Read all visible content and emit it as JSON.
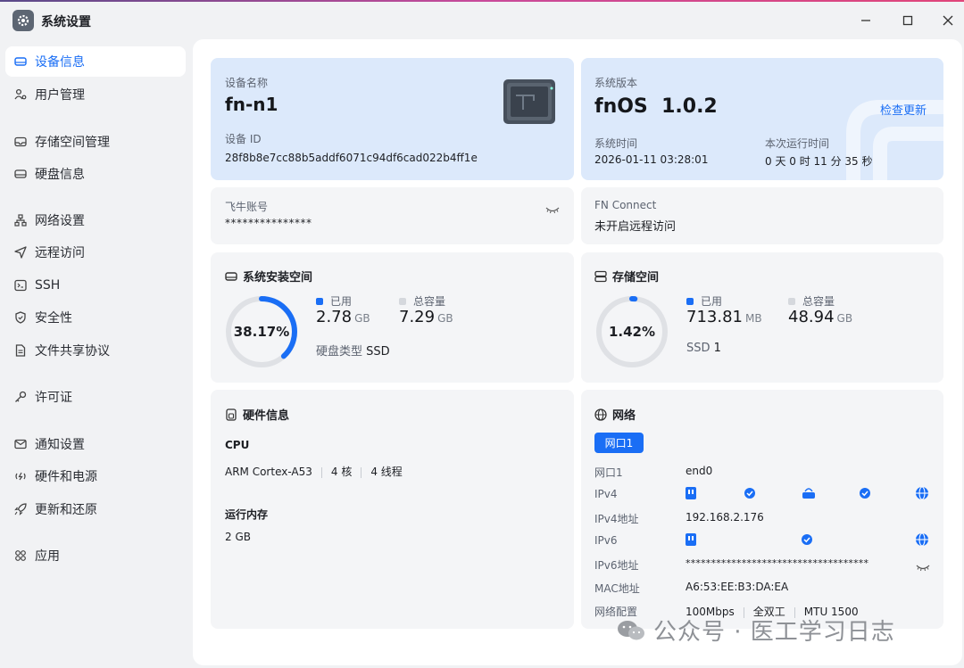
{
  "window": {
    "title": "系统设置"
  },
  "sidebar": {
    "items": [
      {
        "label": "设备信息",
        "icon": "device-icon"
      },
      {
        "label": "用户管理",
        "icon": "users-icon"
      },
      {
        "label": "存储空间管理",
        "icon": "storage-icon"
      },
      {
        "label": "硬盘信息",
        "icon": "disk-icon"
      },
      {
        "label": "网络设置",
        "icon": "network-icon"
      },
      {
        "label": "远程访问",
        "icon": "send-icon"
      },
      {
        "label": "SSH",
        "icon": "terminal-icon"
      },
      {
        "label": "安全性",
        "icon": "shield-icon"
      },
      {
        "label": "文件共享协议",
        "icon": "file-icon"
      },
      {
        "label": "许可证",
        "icon": "key-icon"
      },
      {
        "label": "通知设置",
        "icon": "mail-icon"
      },
      {
        "label": "硬件和电源",
        "icon": "power-icon"
      },
      {
        "label": "更新和还原",
        "icon": "rocket-icon"
      },
      {
        "label": "应用",
        "icon": "apps-icon"
      }
    ]
  },
  "device": {
    "name_label": "设备名称",
    "name": "fn-n1",
    "id_label": "设备 ID",
    "id": "28f8b8e7cc88b5addf6071c94df6cad022b4ff1e"
  },
  "system": {
    "version_label": "系统版本",
    "version": "fnOS  1.0.2",
    "check_update": "检查更新",
    "time_label": "系统时间",
    "time": "2026-01-11 03:28:01",
    "uptime_label": "本次运行时间",
    "uptime": "0 天 0 时 11 分 35 秒"
  },
  "account": {
    "label": "飞牛账号",
    "value": "***************"
  },
  "fnconnect": {
    "label": "FN Connect",
    "value": "未开启远程访问"
  },
  "sys_space": {
    "title": "系统安装空间",
    "percent": "38.17%",
    "percent_value": 38.17,
    "used_label": "已用",
    "used": "2.78",
    "used_unit": "GB",
    "total_label": "总容量",
    "total": "7.29",
    "total_unit": "GB",
    "disk_type_label": "硬盘类型",
    "disk_type": "SSD"
  },
  "storage": {
    "title": "存储空间",
    "percent": "1.42%",
    "percent_value": 1.42,
    "used_label": "已用",
    "used": "713.81",
    "used_unit": "MB",
    "total_label": "总容量",
    "total": "48.94",
    "total_unit": "GB",
    "ssd_label": "SSD",
    "ssd_count": "1"
  },
  "hardware": {
    "title": "硬件信息",
    "cpu_label": "CPU",
    "cpu_model": "ARM Cortex-A53",
    "cores": "4 核",
    "threads": "4 线程",
    "mem_label": "运行内存",
    "mem": "2 GB"
  },
  "network": {
    "title": "网络",
    "tab": "网口1",
    "rows": [
      {
        "label": "网口1",
        "value": "end0"
      },
      {
        "label": "IPv4",
        "value": ""
      },
      {
        "label": "IPv4地址",
        "value": "192.168.2.176"
      },
      {
        "label": "IPv6",
        "value": ""
      },
      {
        "label": "IPv6地址",
        "value": "************************************"
      },
      {
        "label": "MAC地址",
        "value": "A6:53:EE:B3:DA:EA"
      },
      {
        "label": "网络配置",
        "value": ""
      }
    ],
    "config": {
      "speed": "100Mbps",
      "duplex": "全双工",
      "mtu": "MTU 1500"
    }
  },
  "watermark": "公众号 · 医工学习日志",
  "colors": {
    "accent": "#1a6ef5",
    "ring_track": "#dfe1e5",
    "blue_card": "#dce9fb"
  }
}
